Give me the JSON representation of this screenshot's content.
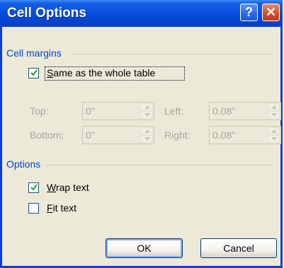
{
  "dialog": {
    "title": "Cell Options",
    "help_label": "?",
    "close_label": "✕"
  },
  "cell_margins": {
    "group_label": "Cell margins",
    "same_as_table": {
      "label_mnemonic": "S",
      "label_rest": "ame as the whole table",
      "checked": true
    },
    "top": {
      "label": "Top:",
      "value": "0\""
    },
    "left": {
      "label": "Left:",
      "value": "0.08\""
    },
    "bottom": {
      "label": "Bottom:",
      "value": "0\""
    },
    "right": {
      "label": "Right:",
      "value": "0.08\""
    },
    "enabled": false
  },
  "options": {
    "group_label": "Options",
    "wrap_text": {
      "label_mnemonic": "W",
      "label_rest": "rap text",
      "checked": true
    },
    "fit_text": {
      "label_mnemonic": "F",
      "label_rest": "it text",
      "checked": false
    }
  },
  "buttons": {
    "ok": "OK",
    "cancel": "Cancel"
  },
  "colors": {
    "titlebar": "#0a4fdc",
    "client_bg": "#ece9d8",
    "group_title": "#0046d5",
    "disabled_text": "#a7a69a",
    "checkmark": "#21a121"
  }
}
